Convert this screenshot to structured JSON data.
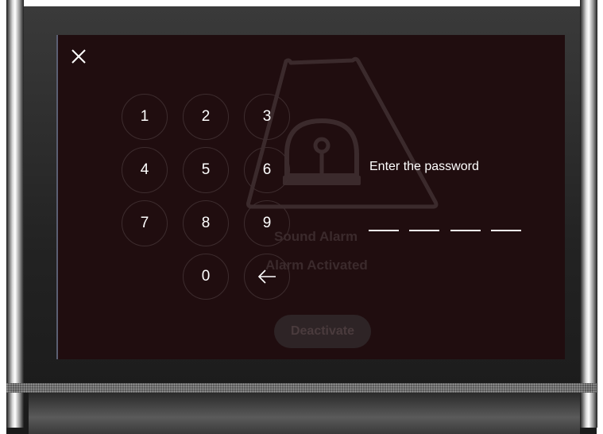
{
  "background": {
    "alarm_title": "Sound Alarm",
    "alarm_status": "Alarm Activated",
    "deactivate_label": "Deactivate"
  },
  "dialog": {
    "close_icon": "close-icon",
    "prompt": "Enter the password",
    "keys": [
      "1",
      "2",
      "3",
      "4",
      "5",
      "6",
      "7",
      "8",
      "9",
      "0"
    ],
    "backspace_icon": "arrow-left-icon",
    "digit_slots": 4
  },
  "colors": {
    "screen_bg": "#200d0f",
    "key_border": "#3d2c2e",
    "text": "#ffffff"
  }
}
